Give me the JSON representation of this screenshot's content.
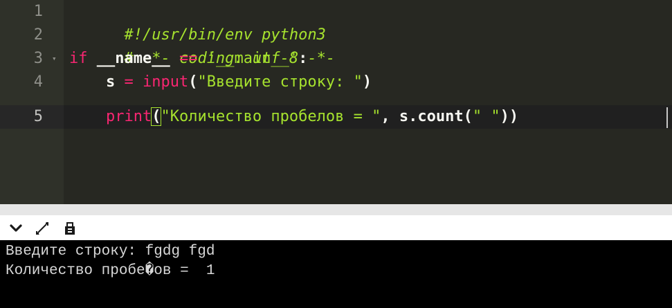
{
  "editor": {
    "lines": [
      {
        "number": "1",
        "tokens": [
          {
            "text": "#!/usr/bin/env python3",
            "kind": "comment"
          }
        ]
      },
      {
        "number": "2",
        "tokens": [
          {
            "text": "# -*- coding: utf-8 -*-",
            "kind": "comment"
          }
        ]
      },
      {
        "number": "3",
        "foldable": true,
        "tokens": [
          {
            "text": "if",
            "kind": "kw"
          },
          {
            "text": " ",
            "kind": "plain"
          },
          {
            "text": "__name__",
            "kind": "name"
          },
          {
            "text": " ",
            "kind": "plain"
          },
          {
            "text": "==",
            "kind": "kw"
          },
          {
            "text": " ",
            "kind": "plain"
          },
          {
            "text": "'__main__'",
            "kind": "str"
          },
          {
            "text": ":",
            "kind": "punc"
          }
        ]
      },
      {
        "number": "4",
        "tokens": [
          {
            "text": "    ",
            "kind": "plain"
          },
          {
            "text": "s",
            "kind": "name"
          },
          {
            "text": " ",
            "kind": "plain"
          },
          {
            "text": "=",
            "kind": "kw"
          },
          {
            "text": " ",
            "kind": "plain"
          },
          {
            "text": "input",
            "kind": "func"
          },
          {
            "text": "(",
            "kind": "punc"
          },
          {
            "text": "\"Введите строку: \"",
            "kind": "str"
          },
          {
            "text": ")",
            "kind": "punc"
          }
        ]
      },
      {
        "number": "5",
        "active": true,
        "tokens": [
          {
            "text": "    ",
            "kind": "plain"
          },
          {
            "text": "print",
            "kind": "func"
          },
          {
            "text": "(",
            "kind": "cursorparen"
          },
          {
            "text": "\"Количество пробелов = \"",
            "kind": "str"
          },
          {
            "text": ", ",
            "kind": "punc"
          },
          {
            "text": "s.count(",
            "kind": "name"
          },
          {
            "text": "\" \"",
            "kind": "str"
          },
          {
            "text": "))",
            "kind": "punc"
          }
        ]
      }
    ]
  },
  "toolbar": {
    "icons": [
      "chevron-down-icon",
      "expand-icon",
      "clear-console-icon"
    ]
  },
  "console": {
    "lines": [
      "Введите строку: fgdg fgd",
      "Количество пробе�ов =  1"
    ]
  },
  "colors": {
    "editor_bg": "#272822",
    "gutter_bg": "#2f3129",
    "active_line_bg": "#202020",
    "keyword": "#f92672",
    "string": "#a6e22e",
    "console_bg": "#000000",
    "console_fg": "#d8d8d8"
  }
}
